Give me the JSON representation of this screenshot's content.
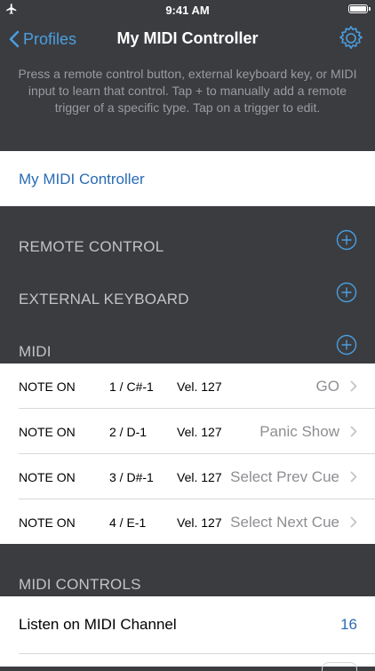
{
  "status_bar": {
    "time": "9:41 AM",
    "airplane_icon": "airplane-icon",
    "battery_icon": "battery-icon",
    "battery_level": 1.0
  },
  "nav": {
    "back_label": "Profiles",
    "title": "My MIDI Controller",
    "settings_icon": "gear-icon",
    "accent_color": "#4a9fe0"
  },
  "help_text": "Press a remote control button, external keyboard key, or MIDI input to learn that control. Tap + to manually add a remote trigger of a specific type. Tap on a trigger to edit.",
  "profile_name": "My MIDI Controller",
  "sections": {
    "remote_control": "REMOTE CONTROL",
    "external_keyboard": "EXTERNAL KEYBOARD",
    "midi": "MIDI",
    "midi_controls": "MIDI CONTROLS"
  },
  "midi_triggers": [
    {
      "type": "NOTE ON",
      "note": "1 / C#-1",
      "velocity": "Vel. 127",
      "action": "GO"
    },
    {
      "type": "NOTE ON",
      "note": "2 / D-1",
      "velocity": "Vel. 127",
      "action": "Panic Show"
    },
    {
      "type": "NOTE ON",
      "note": "3 / D#-1",
      "velocity": "Vel. 127",
      "action": "Select Prev Cue"
    },
    {
      "type": "NOTE ON",
      "note": "4 / E-1",
      "velocity": "Vel. 127",
      "action": "Select Next Cue"
    }
  ],
  "midi_controls": {
    "listen_label": "Listen on MIDI Channel",
    "listen_value": "16"
  },
  "colors": {
    "background": "#3b3c40",
    "link_blue": "#2a6bb5",
    "section_text": "#c2c3c7"
  }
}
